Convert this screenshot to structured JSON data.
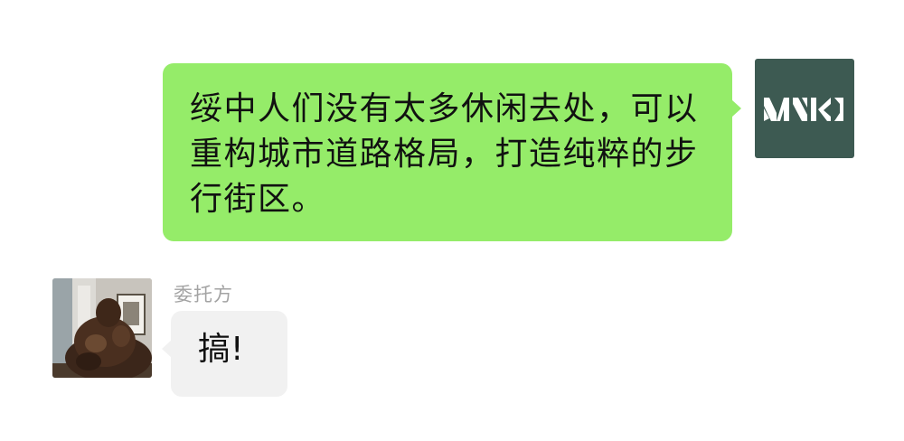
{
  "conversation": {
    "outgoing": {
      "text": "绥中人们没有太多休闲去处，可以重构城市道路格局，打造纯粹的步行街区。",
      "avatar_icon": "mvki-logo-avatar",
      "avatar_logo_text": "MVKI",
      "bubble_color": "#95ec69",
      "avatar_color": "#3d5a52"
    },
    "incoming": {
      "sender_name": "委托方",
      "text": "搞!",
      "avatar_icon": "sculpture-photo-avatar",
      "bubble_color": "#f1f1f1"
    }
  }
}
